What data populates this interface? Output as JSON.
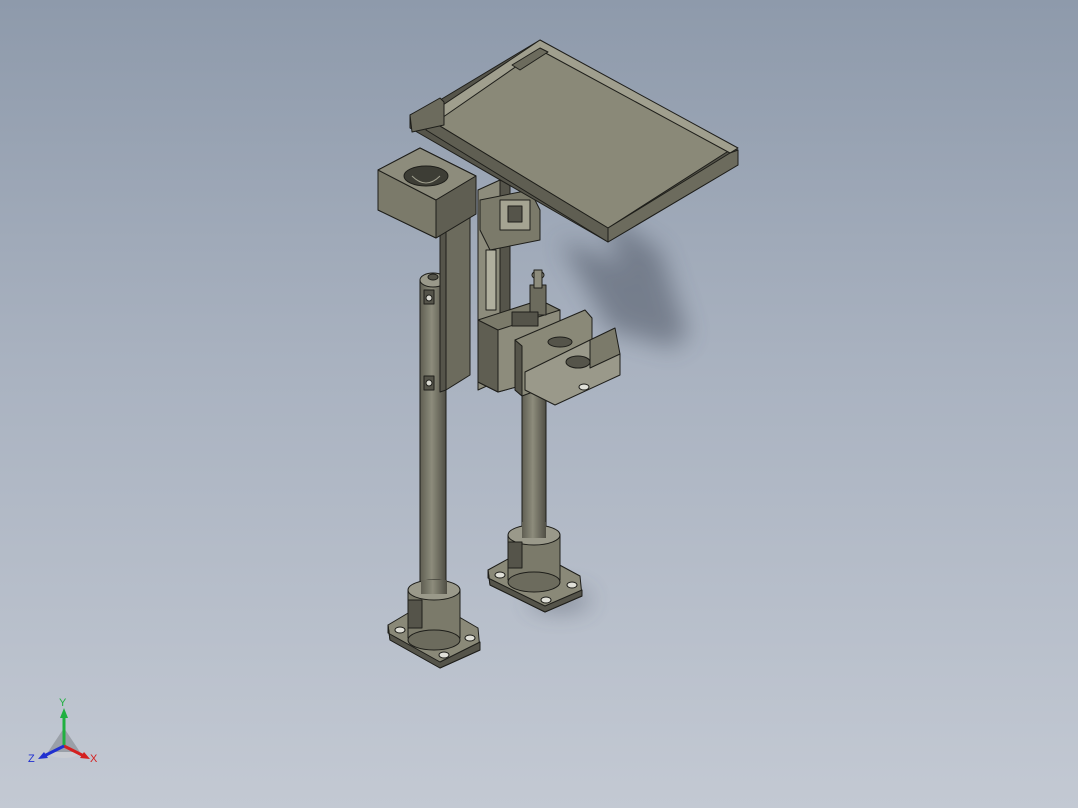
{
  "viewport": {
    "background_top": "#8e9aab",
    "background_bottom": "#c3c9d3"
  },
  "model": {
    "part_color": "#7b7a6a",
    "part_dark": "#55544a",
    "part_light": "#a09f8e",
    "edge_color": "#1e1e1a"
  },
  "triad": {
    "x_label": "X",
    "y_label": "Y",
    "z_label": "Z",
    "x_color": "#d42020",
    "y_color": "#20b040",
    "z_color": "#2030d0"
  }
}
